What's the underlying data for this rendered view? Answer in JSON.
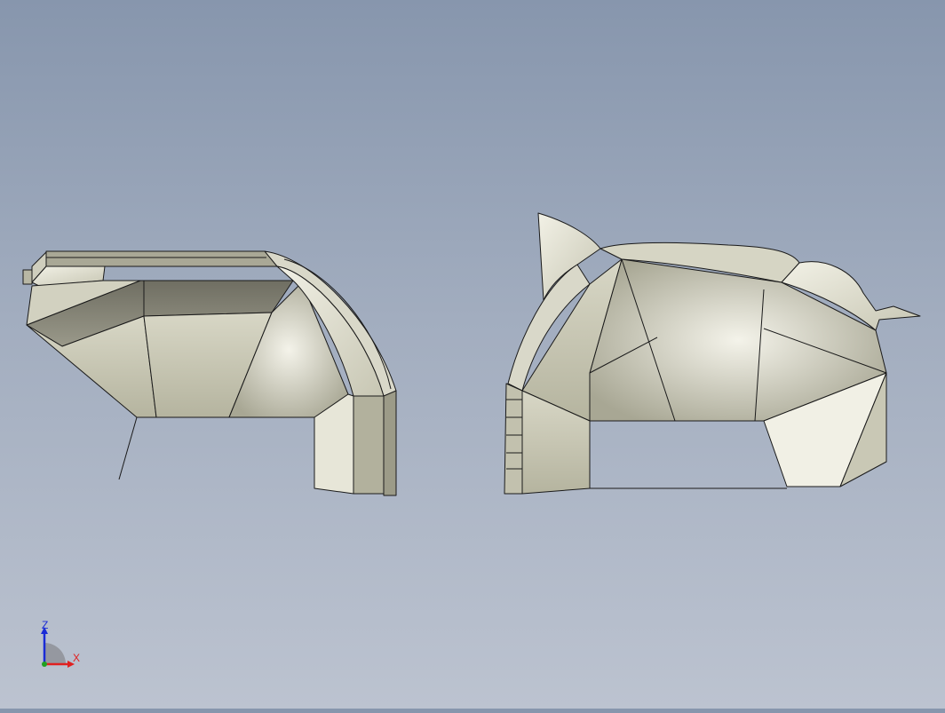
{
  "triad": {
    "z_label": "Z",
    "x_label": "X",
    "z_color": "#1a2bd6",
    "x_color": "#e02020",
    "y_color": "#20a020"
  },
  "model": {
    "face_color": "#c9c8b6",
    "edge_color": "#1a1a1a",
    "background_top": "#8796ad",
    "background_bottom": "#bcc3d0"
  }
}
